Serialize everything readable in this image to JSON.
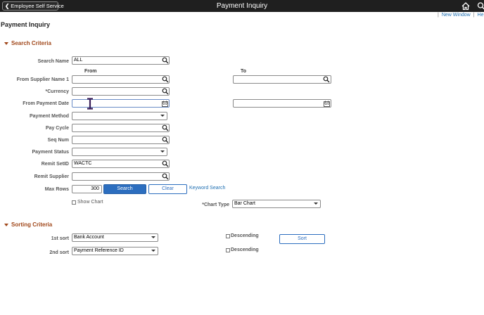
{
  "banner": {
    "back_label": "Employee Self Service",
    "title": "Payment Inquiry",
    "icons": [
      "home-icon",
      "search-icon"
    ]
  },
  "toplinks": {
    "new_window": "New Window",
    "help": "He"
  },
  "page_title": "Payment Inquiry",
  "search_criteria": {
    "header": "Search Criteria",
    "col_from": "From",
    "col_to": "To",
    "search_name": {
      "label": "Search Name",
      "value": "ALL"
    },
    "from_supplier": {
      "label": "From Supplier Name 1",
      "from_value": "",
      "to_value": ""
    },
    "currency": {
      "label": "*Currency",
      "value": ""
    },
    "from_payment_date": {
      "label": "From Payment Date",
      "from_value": "",
      "to_value": ""
    },
    "payment_method": {
      "label": "Payment Method",
      "value": ""
    },
    "pay_cycle": {
      "label": "Pay Cycle",
      "value": ""
    },
    "seq_num": {
      "label": "Seq Num",
      "value": ""
    },
    "payment_status": {
      "label": "Payment Status",
      "value": ""
    },
    "remit_setid": {
      "label": "Remit SetID",
      "value": "WACTC"
    },
    "remit_supplier": {
      "label": "Remit Supplier",
      "value": ""
    },
    "max_rows": {
      "label": "Max Rows",
      "value": "300"
    },
    "search_button": "Search",
    "clear_button": "Clear",
    "keyword_search": "Keyword Search",
    "show_chart": {
      "label": "Show Chart",
      "checked": false
    },
    "chart_type": {
      "label": "*Chart Type",
      "value": "Bar Chart"
    }
  },
  "sorting_criteria": {
    "header": "Sorting Criteria",
    "first_sort": {
      "label": "1st sort",
      "value": "Bank Account",
      "descending_label": "Descending",
      "descending": false
    },
    "second_sort": {
      "label": "2nd sort",
      "value": "Payment Reference ID",
      "descending_label": "Descending",
      "descending": false
    },
    "sort_button": "Sort"
  },
  "colors": {
    "accent": "#2c6ebf",
    "section_header": "#a0471a",
    "banner": "#1f1f1f",
    "link": "#1f6fb2"
  }
}
